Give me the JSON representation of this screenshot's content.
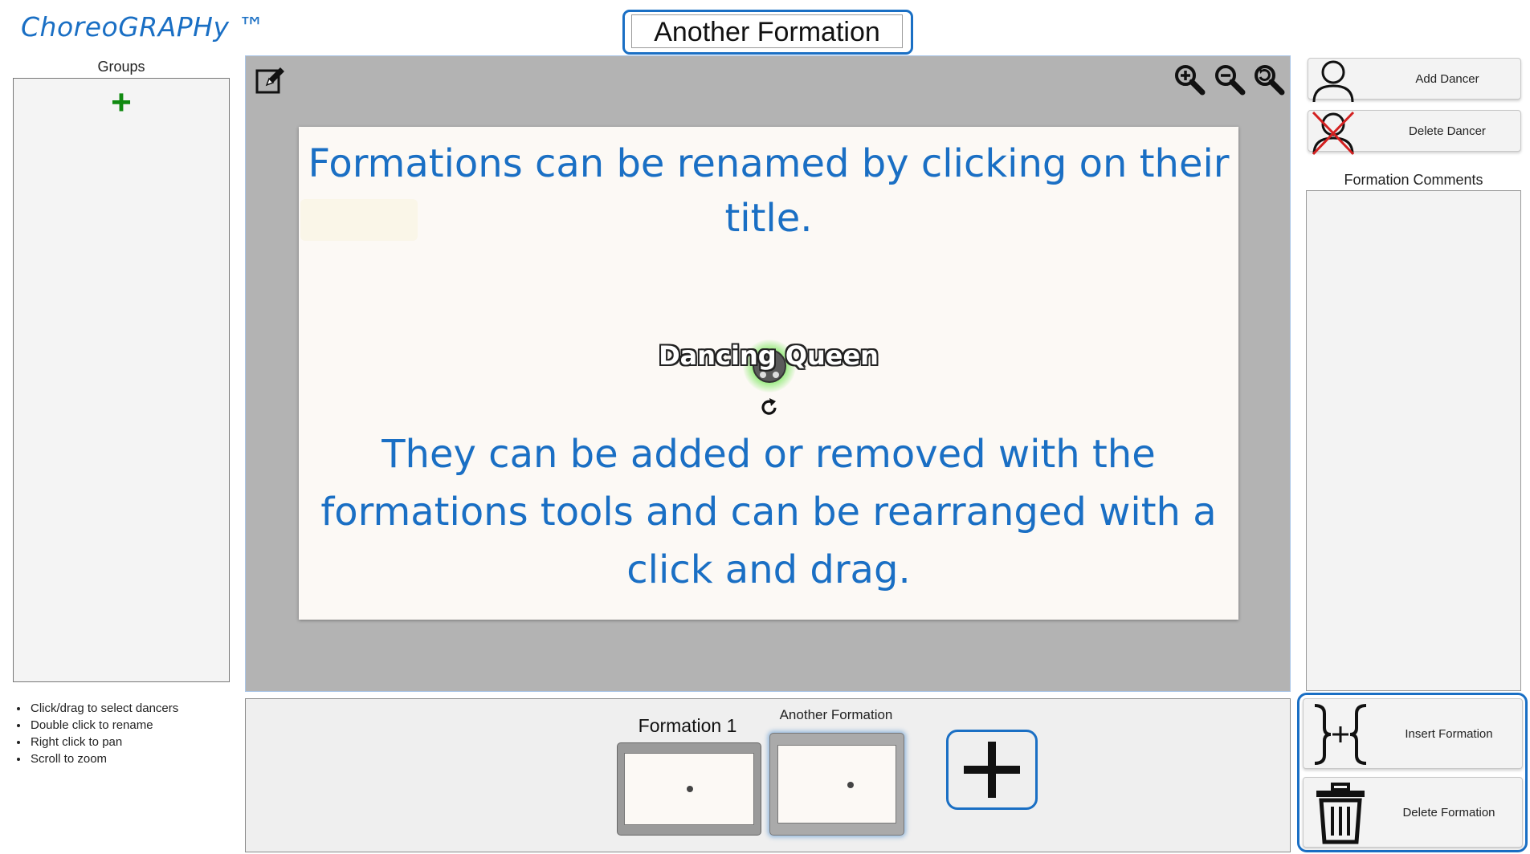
{
  "app": {
    "title": "ChoreoGRAPHy ™",
    "formation_title": "Another Formation"
  },
  "left_panel": {
    "groups_label": "Groups",
    "add_icon": "plus-icon",
    "help": [
      "Click/drag to select dancers",
      "Double click to rename",
      "Right click to pan",
      "Scroll to zoom"
    ]
  },
  "stage": {
    "toolbar_icons": [
      "edit-icon",
      "zoom-in-icon",
      "zoom-out-icon",
      "zoom-reset-icon"
    ],
    "notes": [
      "Formations can be renamed by clicking on their title.",
      "They can be added or removed with the formations tools and can be rearranged with a click and drag."
    ],
    "dancer": {
      "name": "Dancing Queen",
      "glow_color": "#7be35a"
    }
  },
  "timeline": {
    "formations": [
      {
        "label": "Formation 1"
      },
      {
        "label": "Another Formation",
        "selected": true
      }
    ],
    "add_icon": "plus-icon"
  },
  "right_panel": {
    "add_dancer_label": "Add Dancer",
    "delete_dancer_label": "Delete Dancer",
    "comments_label": "Formation Comments",
    "insert_formation_label": "Insert Formation",
    "delete_formation_label": "Delete Formation"
  },
  "colors": {
    "accent": "#1a6fc4",
    "add_green": "#118a11",
    "stage_bg": "#b3b3b3",
    "canvas_bg": "#fcf9f5",
    "delete_red": "#d32020"
  }
}
